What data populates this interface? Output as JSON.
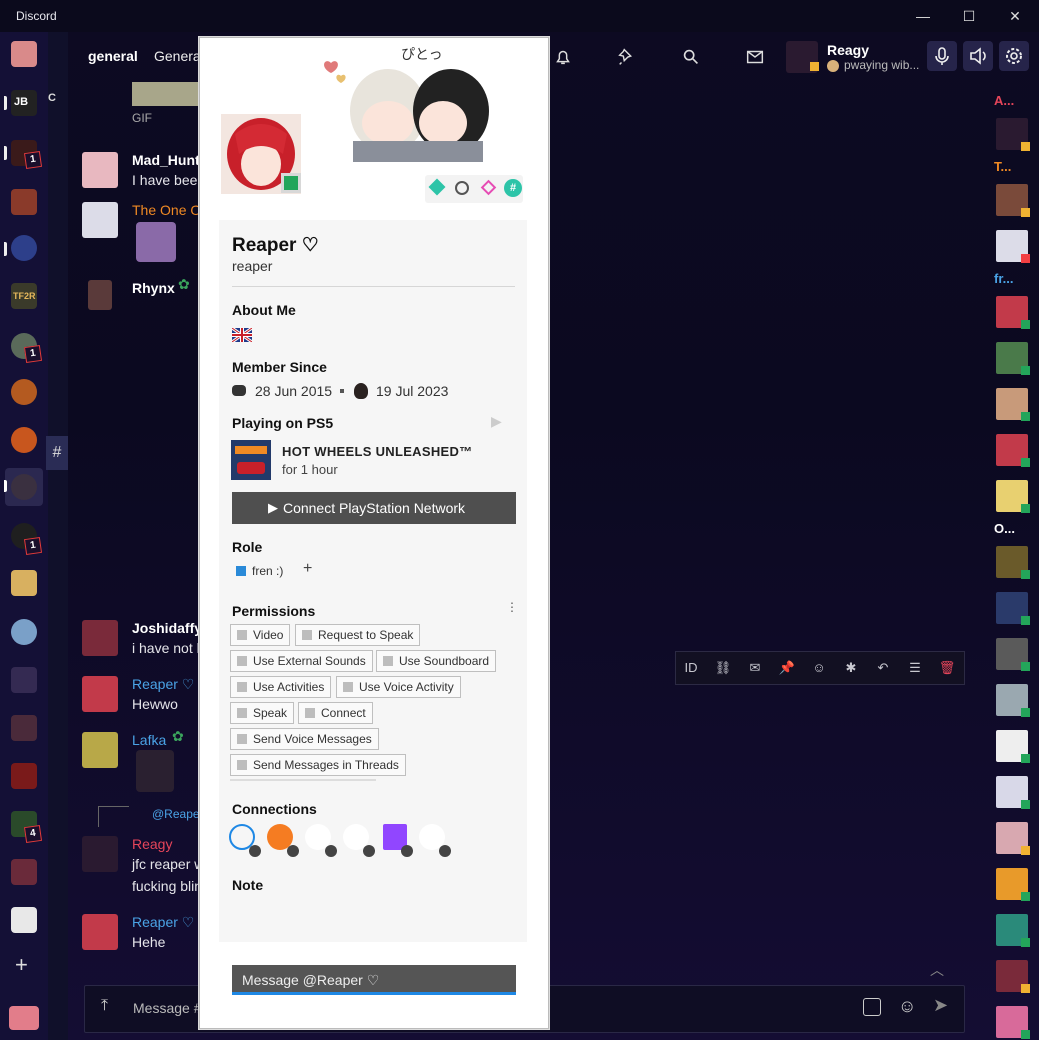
{
  "window": {
    "title": "Discord",
    "minimize": "—",
    "maximize": "☐",
    "close": "✕"
  },
  "header": {
    "channel": "general",
    "channel2": "Genera",
    "user_name": "Reagy",
    "user_status": "pwaying wib..."
  },
  "guild_badges": [
    "1",
    "1",
    "1",
    "4"
  ],
  "channel_hash": "#",
  "messages": [
    {
      "name": "Mad_Hunt",
      "text": "I have bee",
      "color": "#ffffff"
    },
    {
      "name": "The One O",
      "text": "",
      "color": "#f08a24"
    },
    {
      "name": "Rhynx",
      "text": "",
      "color": "#ffffff"
    },
    {
      "name": "Joshidaffy",
      "text": "i have not l",
      "color": "#ffffff"
    },
    {
      "name": "Reaper ♡",
      "text": "Hewwo",
      "color": "#4aa3e6"
    },
    {
      "name": "Lafka",
      "text": "",
      "color": "#4aa3e6"
    },
    {
      "name": "Reagy",
      "text": "jfc reaper w",
      "text2": "fucking blin",
      "color": "#e5455a"
    },
    {
      "name": "Reaper ♡",
      "text": "Hehe",
      "color": "#4aa3e6"
    }
  ],
  "reply_preview": "@Reape",
  "gif_label": "GIF",
  "members": {
    "groups": [
      "A...",
      "T...",
      "fr...",
      "O..."
    ],
    "group_colors": [
      "#e5455a",
      "#f08a24",
      "#4aa3e6",
      "#ffffff"
    ]
  },
  "toolbar": {
    "id_label": "ID"
  },
  "composer": {
    "placeholder": "Message #"
  },
  "profile": {
    "display_name": "Reaper ♡",
    "username": "reaper",
    "about_title": "About Me",
    "member_since_title": "Member Since",
    "discord_joined": "28 Jun 2015",
    "server_joined": "19 Jul 2023",
    "playing_title": "Playing on PS5",
    "game_title": "HOT WHEELS UNLEASHED™",
    "game_time": "for 1 hour",
    "connect_button": "Connect PlayStation Network",
    "role_title": "Role",
    "role_name": "fren :)",
    "role_add": "+",
    "permissions_title": "Permissions",
    "permissions": [
      "Video",
      "Request to Speak",
      "Use External Sounds",
      "Use Soundboard",
      "Use Activities",
      "Use Voice Activity",
      "Speak",
      "Connect",
      "Send Voice Messages",
      "Send Messages in Threads"
    ],
    "connections_title": "Connections",
    "note_title": "Note",
    "message_placeholder": "Message @Reaper ♡"
  },
  "colors": {
    "accent": "#1e88e5",
    "online": "#23a55a",
    "idle": "#f0b232",
    "dnd": "#f23f43"
  }
}
